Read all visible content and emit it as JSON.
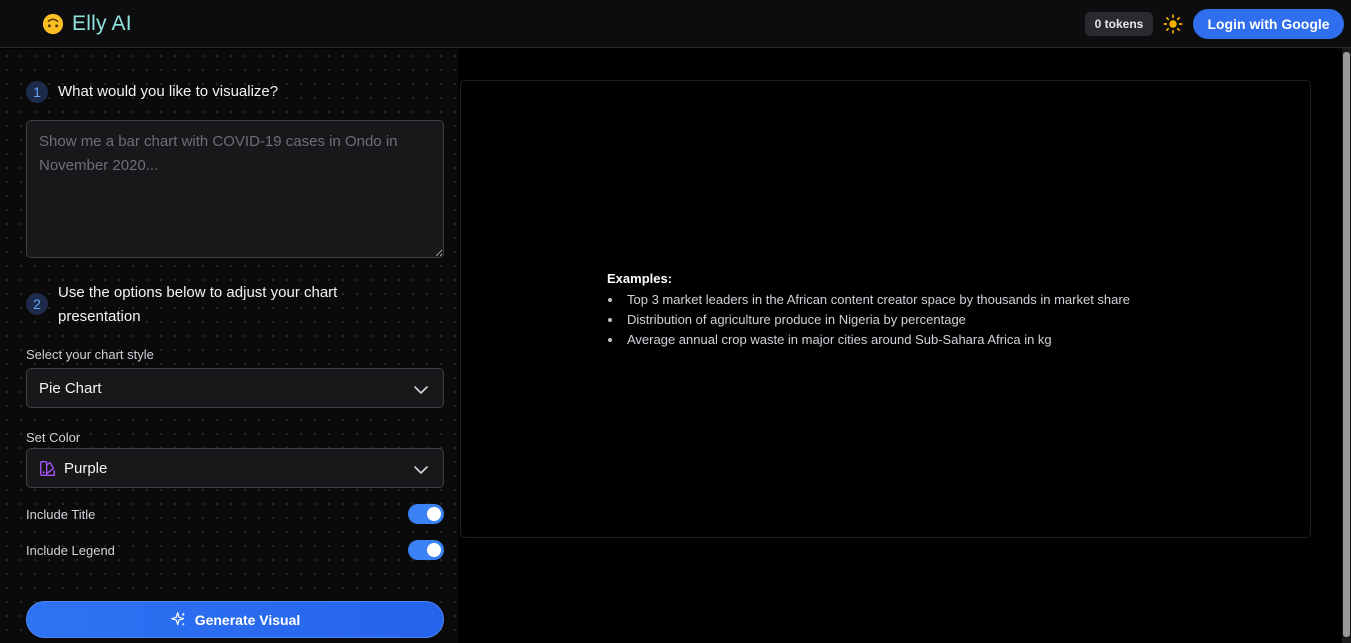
{
  "header": {
    "app_name": "Elly AI",
    "tokens": "0 tokens",
    "login_label": "Login with Google"
  },
  "steps": {
    "step1": {
      "number": "1",
      "title": "What would you like to visualize?"
    },
    "step2": {
      "number": "2",
      "title": "Use the options below to adjust your chart presentation"
    }
  },
  "prompt": {
    "value": "",
    "placeholder": "Show me a bar chart with COVID-19 cases in Ondo in November 2020..."
  },
  "chart_style": {
    "label": "Select your chart style",
    "selected": "Pie Chart"
  },
  "color": {
    "label": "Set Color",
    "selected": "Purple",
    "accent": "#a855f7"
  },
  "toggles": {
    "title": {
      "label": "Include Title",
      "on": true
    },
    "legend": {
      "label": "Include Legend",
      "on": true
    }
  },
  "generate_label": "Generate Visual",
  "examples": {
    "heading": "Examples:",
    "items": [
      "Top 3 market leaders in the African content creator space by thousands in market share",
      "Distribution of agriculture produce in Nigeria by percentage",
      "Average annual crop waste in major cities around Sub-Sahara Africa in kg"
    ]
  },
  "colors": {
    "primary": "#2f6fee",
    "brand_text": "#8ee3dc",
    "sun": "#f5b301"
  },
  "icons": [
    "emoji-face-icon",
    "sun-icon",
    "chevron-down-icon",
    "palette-icon",
    "sparkles-icon"
  ]
}
